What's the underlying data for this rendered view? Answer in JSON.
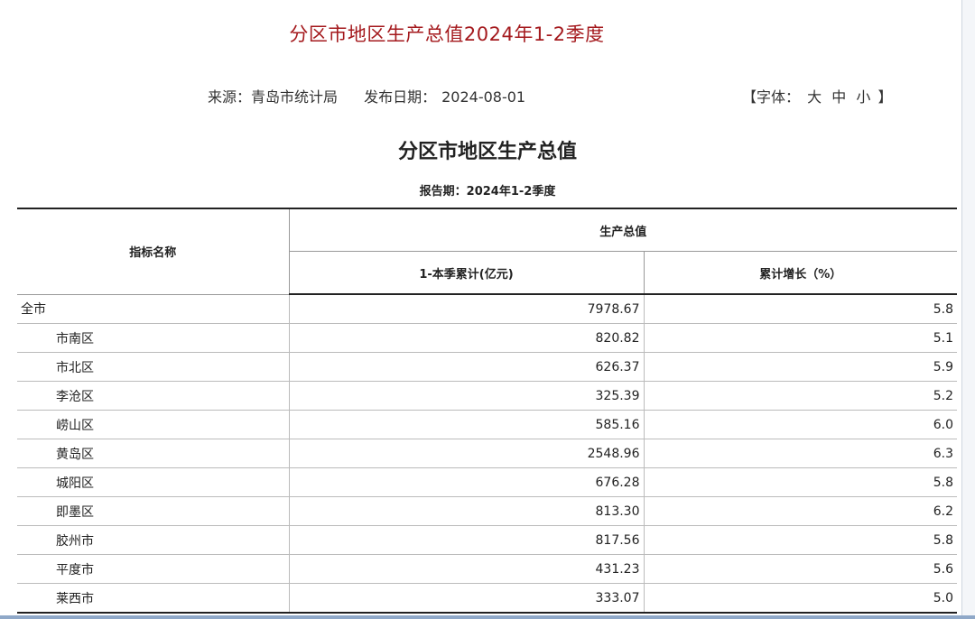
{
  "page_title": "分区市地区生产总值2024年1-2季度",
  "meta": {
    "source": "来源：青岛市统计局",
    "date_label": "发布日期：",
    "date_value": "2024-08-01",
    "font_open": "【字体：",
    "font_large": "大",
    "font_medium": "中",
    "font_small": "小",
    "font_close": "】"
  },
  "table": {
    "title": "分区市地区生产总值",
    "period": "报告期：2024年1-2季度",
    "headers": {
      "indicator": "指标名称",
      "group": "生产总值",
      "col1": "1-本季累计(亿元)",
      "col2": "累计增长（%）"
    },
    "rows": [
      {
        "name": "全市",
        "value": "7978.67",
        "growth": "5.8"
      },
      {
        "name": "市南区",
        "value": "820.82",
        "growth": "5.1"
      },
      {
        "name": "市北区",
        "value": "626.37",
        "growth": "5.9"
      },
      {
        "name": "李沧区",
        "value": "325.39",
        "growth": "5.2"
      },
      {
        "name": "崂山区",
        "value": "585.16",
        "growth": "6.0"
      },
      {
        "name": "黄岛区",
        "value": "2548.96",
        "growth": "6.3"
      },
      {
        "name": "城阳区",
        "value": "676.28",
        "growth": "5.8"
      },
      {
        "name": "即墨区",
        "value": "813.30",
        "growth": "6.2"
      },
      {
        "name": "胶州市",
        "value": "817.56",
        "growth": "5.8"
      },
      {
        "name": "平度市",
        "value": "431.23",
        "growth": "5.6"
      },
      {
        "name": "莱西市",
        "value": "333.07",
        "growth": "5.0"
      }
    ]
  }
}
